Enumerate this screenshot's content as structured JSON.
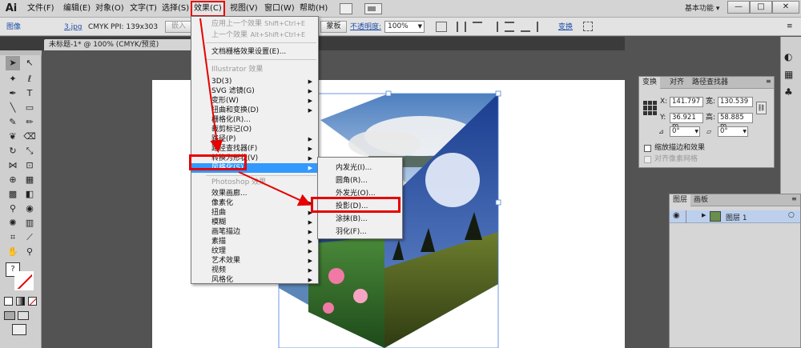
{
  "app": {
    "logo": "Ai",
    "workspace": "基本功能 ▾"
  },
  "menubar": {
    "items": [
      "文件(F)",
      "编辑(E)",
      "对象(O)",
      "文字(T)",
      "选择(S)",
      "效果(C)",
      "视图(V)",
      "窗口(W)",
      "帮助(H)"
    ],
    "window_buttons": [
      "—",
      "□",
      "✕"
    ]
  },
  "controlbar": {
    "label": "图像",
    "filename": "3.jpg",
    "colormode": "CMYK",
    "ppi": "PPI: 139x303",
    "embed_btn": "嵌入",
    "mask_btn": "蒙板",
    "opacity_label": "不透明度:",
    "opacity_value": "100%",
    "transform_link": "变换"
  },
  "document": {
    "tab": "未标题-1* @ 100% (CMYK/预览)",
    "close": "✕"
  },
  "effect_menu": {
    "apply_last": "应用上一个效果",
    "apply_last_shortcut": "Shift+Ctrl+E",
    "last_effect": "上一个效果",
    "last_effect_shortcut": "Alt+Shift+Ctrl+E",
    "doc_raster": "文档栅格效果设置(E)...",
    "illustrator_header": "Illustrator 效果",
    "illustrator_items": [
      "3D(3)",
      "SVG 滤镜(G)",
      "变形(W)",
      "扭曲和变换(D)",
      "栅格化(R)...",
      "裁剪标记(O)",
      "路径(P)",
      "路径查找器(F)",
      "转换为形状(V)"
    ],
    "stylize": "风格化(S)",
    "photoshop_header": "Photoshop 效果",
    "photoshop_items": [
      "效果画廊...",
      "像素化",
      "扭曲",
      "模糊",
      "画笔描边",
      "素描",
      "纹理",
      "艺术效果",
      "视频",
      "风格化"
    ]
  },
  "stylize_submenu": {
    "items": [
      "内发光(I)...",
      "圆角(R)...",
      "外发光(O)...",
      "投影(D)...",
      "涂抹(B)...",
      "羽化(F)..."
    ]
  },
  "transform_panel": {
    "tabs": [
      "变换",
      "对齐",
      "路径查找器"
    ],
    "x_label": "X:",
    "x_value": "141.797",
    "w_label": "宽:",
    "w_value": "130.539",
    "y_label": "Y:",
    "y_value": "36.921 m",
    "h_label": "高:",
    "h_value": "58.885 m",
    "angle_value": "0°",
    "shear_value": "0°",
    "scale_strokes": "缩放描边和效果",
    "align_pixel": "对齐像素网格"
  },
  "layers_panel": {
    "tabs": [
      "图层",
      "画板"
    ],
    "layer_name": "图层 1"
  },
  "colors": {
    "highlight": "#3399ff",
    "annotation": "#e60000"
  }
}
